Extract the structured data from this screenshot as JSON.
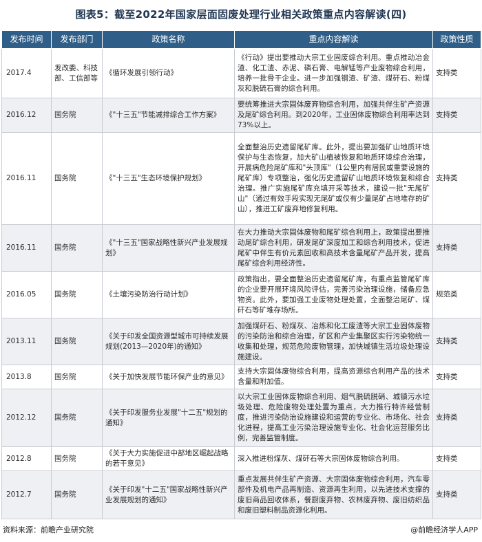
{
  "title": "图表5：截至2022年国家层面固废处理行业相关政策重点内容解读(四)",
  "columns": [
    "发布时间",
    "发布部门",
    "政策名称",
    "重点内容解读",
    "政策性质"
  ],
  "rows": [
    {
      "date": "2017.4",
      "dept": "发改委、科技部、工信部等",
      "name": "《循环发展引领行动》",
      "focus": "《行动》提出要推动大宗工业固废综合利用。重点推动冶金渣、化工渣、赤泥、磷石膏、电解锰等产业废物综合利用，培养一批骨干企业。进一步加强钢渣、矿渣、煤矸石、粉煤灰和脱硫石膏的综合利用。",
      "nature": "支持类"
    },
    {
      "date": "2016.12",
      "dept": "国务院",
      "name": "《\"十三五\"节能减排综合工作方案》",
      "focus": "要统筹推进大宗固体废弃物综合利用，加强共伴生矿产资源及尾矿综合利用。到2020年，工业固体废物综合利用率达到73%以上。",
      "nature": "支持类"
    },
    {
      "date": "2016.11",
      "dept": "国务院",
      "name": "《\"十三五\"生态环境保护规划》",
      "focus": "全面整治历史遗留尾矿库。此外，提出要加强矿山地质环境保护与生态恢复，加大矿山植被恢复和地质环境综合治理，开展病危险尾矿库和\"头顶库\"（1公里内有居民或重要设施的尾矿库）专项整治，强化历史遗留矿山地质环境恢复和综合治理。推广实施尾矿库充填开采等技术，建设一批\"无尾矿山\"（通过有效手段实现无尾矿或仅有少量尾矿占地堆存的矿山），推进工矿废弃地修复利用。",
      "nature": "支持类"
    },
    {
      "date": "2016.11",
      "dept": "国务院",
      "name": "《\"十三五\"国家战略性新兴产业发展规划》",
      "focus": "在大力推动大宗固体废物和尾矿综合利用上，政策提出要推动尾矿综合利用，研发尾矿深度加工和综合利用技术，促进尾矿中伴生有价元素回收和高技术含量尾矿产品开发，提高尾矿综合利用经济性。",
      "nature": "支持类"
    },
    {
      "date": "2016.05",
      "dept": "国务院",
      "name": "《土壤污染防治行动计划》",
      "focus": "政策指出，要全面整治历史遗留尾矿库，有重点监管尾矿库的企业要开展环境风险评估，完善污染治理设施，储备应急物资。此外，要加强工业废物处理处置，全面整治尾矿、煤矸石等矿堆存场所。",
      "nature": "规范类"
    },
    {
      "date": "2013.11",
      "dept": "国务院",
      "name": "《关于印发全国资源型城市可持续发展规划(2013—2020年)的通知》",
      "focus": "加强煤矸石、粉煤灰、冶炼和化工废渣等大宗工业固体废物的污染防治和综合治理，矿区和产业集聚区实行污染物统一收集和处理，规范危险废物管理，加快城镇生活垃圾处理设施建设。",
      "nature": "支持类"
    },
    {
      "date": "2013.8",
      "dept": "国务院",
      "name": "《关于加快发展节能环保产业的意见》",
      "focus": "支持大宗固体废物综合利用，提高资源综合利用产品的技术含量和附加值。",
      "nature": "支持类"
    },
    {
      "date": "2012.12",
      "dept": "国务院",
      "name": "《关于印发服务业发展\"十二五\"规划的通知》",
      "focus": "以大宗工业固体废物综合利用、烟气脱硫脱硝、城镇污水垃圾处理、危险废物处理处置为重点，大力推行特许经营制度，推进污染防治设施建设和运营的专业化、市场化、社会化进程，提高工业污染治理设施专业化、社会化运营服务比例，完善监管制度。",
      "nature": "支持类"
    },
    {
      "date": "2012.8",
      "dept": "国务院",
      "name": "《关于大力实施促进中部地区崛起战略的若干意见》",
      "focus": "深入推进粉煤灰、煤矸石等大宗固体废物综合利用。",
      "nature": "支持类"
    },
    {
      "date": "2012.7",
      "dept": "国务院",
      "name": "《关于印发\"十二五\"国家战略性新兴产业发展规划的通知》",
      "focus": "重点发展共伴生矿产资源、大宗固体废物综合利用，汽车零部件及机电产品再制造、资源再生利用，以先进技术支撑的废旧商品回收体系，餐厨废弃物、农林废弃物、废旧纺织品和废旧塑料制品资源化利用。",
      "nature": "支持类"
    }
  ],
  "footer": {
    "source": "资料来源：前瞻产业研究院",
    "brand": "@前瞻经济学人APP"
  }
}
